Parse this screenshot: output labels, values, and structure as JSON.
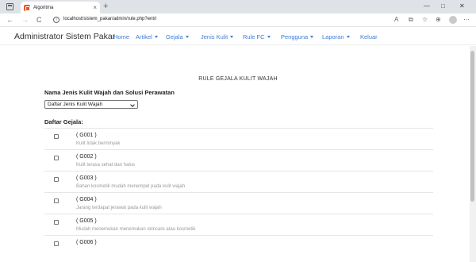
{
  "browser": {
    "tab_title": "Algoritma",
    "tab_close": "×",
    "new_tab": "+",
    "url": "localhost/sistem_pakar/admin/rule.php?entri",
    "controls": {
      "minimize": "—",
      "maximize": "□",
      "close": "✕"
    }
  },
  "navbar": {
    "brand": "Administrator Sistem Pakar",
    "items": [
      {
        "label": "Home",
        "dropdown": false
      },
      {
        "label": "Artikel",
        "dropdown": true
      },
      {
        "label": "Gejala",
        "dropdown": true
      },
      {
        "label": "Jenis Kulit",
        "dropdown": true
      },
      {
        "label": "Rule FC",
        "dropdown": true
      },
      {
        "label": "Pengguna",
        "dropdown": true
      },
      {
        "label": "Laporan",
        "dropdown": true
      },
      {
        "label": "Keluar",
        "dropdown": false
      }
    ],
    "link_color": "#3c7bd6"
  },
  "content": {
    "page_title": "RULE GEJALA KULIT WAJAH",
    "section_label": "Nama Jenis Kulit Wajah dan Solusi Perawatan",
    "select_value": "Daftar Jenis Kulit Wajah",
    "list_label": "Daftar Gejala:",
    "symptoms": [
      {
        "code": "( G001 )",
        "desc": "Kulit tidak berminyak"
      },
      {
        "code": "( G002 )",
        "desc": "Kulit terasa sehat dan halus"
      },
      {
        "code": "( G003 )",
        "desc": "Bahan kosmetik mudah menempel pada kulit wajah"
      },
      {
        "code": "( G004 )",
        "desc": "Jarang terdapat jerawat pada kulit wajah"
      },
      {
        "code": "( G005 )",
        "desc": "Mudah menemukan menemukan skincare atau kosmetik"
      },
      {
        "code": "( G006 )",
        "desc": ""
      }
    ]
  }
}
